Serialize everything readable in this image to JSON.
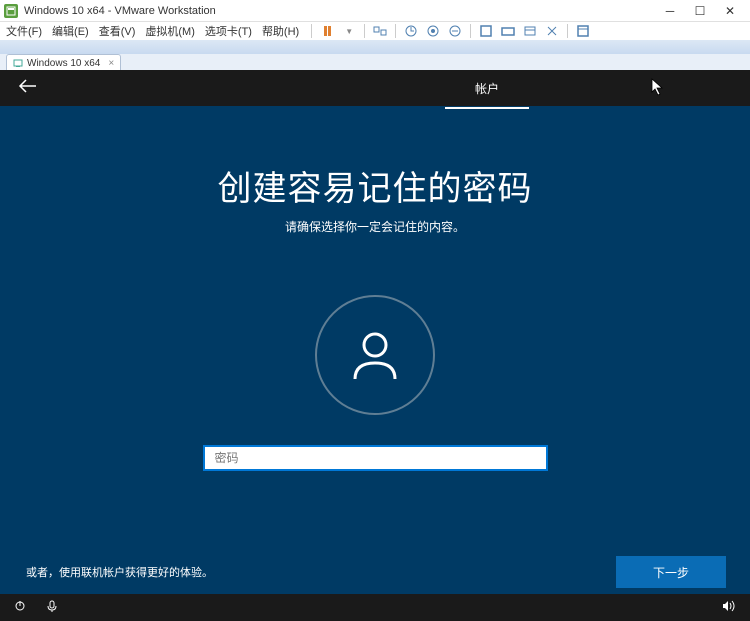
{
  "titlebar": {
    "title": "Windows 10 x64 - VMware Workstation"
  },
  "menubar": {
    "items": [
      "文件(F)",
      "编辑(E)",
      "查看(V)",
      "虚拟机(M)",
      "选项卡(T)",
      "帮助(H)"
    ]
  },
  "tab": {
    "label": "Windows 10 x64"
  },
  "oobe": {
    "tab_label": "帐户",
    "title": "创建容易记住的密码",
    "subtitle": "请确保选择你一定会记住的内容。",
    "password_placeholder": "密码",
    "signin_link": "或者，使用联机帐户获得更好的体验。",
    "next_label": "下一步"
  }
}
